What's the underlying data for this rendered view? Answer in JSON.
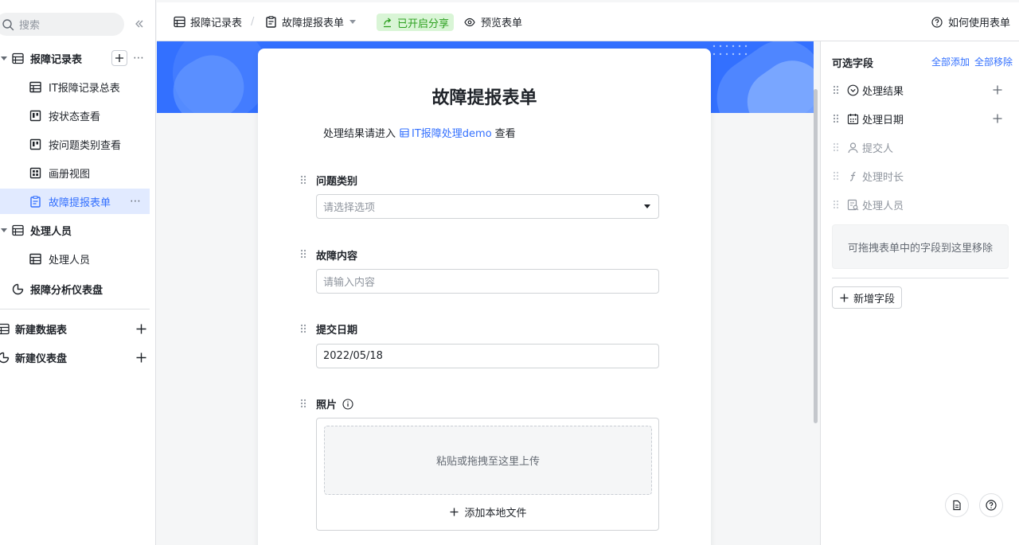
{
  "sidebar": {
    "search_placeholder": "搜索",
    "items": [
      {
        "label": "报障记录表",
        "level": 0,
        "icon": "table-icon"
      },
      {
        "label": "IT报障记录总表",
        "level": 1,
        "icon": "grid-view-icon"
      },
      {
        "label": "按状态查看",
        "level": 1,
        "icon": "kanban-view-icon"
      },
      {
        "label": "按问题类别查看",
        "level": 1,
        "icon": "kanban-view-icon"
      },
      {
        "label": "画册视图",
        "level": 1,
        "icon": "gallery-view-icon"
      },
      {
        "label": "故障提报表单",
        "level": 1,
        "icon": "form-view-icon",
        "selected": true
      },
      {
        "label": "处理人员",
        "level": 0,
        "icon": "table-icon"
      },
      {
        "label": "处理人员",
        "level": 1,
        "icon": "grid-view-icon"
      },
      {
        "label": "报障分析仪表盘",
        "level": 0,
        "icon": "dashboard-icon"
      }
    ],
    "new_table_label": "新建数据表",
    "new_dashboard_label": "新建仪表盘"
  },
  "topbar": {
    "breadcrumb_table": "报障记录表",
    "breadcrumb_view": "故障提报表单",
    "share_label": "已开启分享",
    "preview_label": "预览表单",
    "help_label": "如何使用表单"
  },
  "form": {
    "title": "故障提报表单",
    "desc_prefix": "处理结果请进入",
    "desc_link": "IT报障处理demo",
    "desc_suffix": "查看",
    "fields": [
      {
        "label": "问题类别",
        "placeholder": "请选择选项",
        "type": "select"
      },
      {
        "label": "故障内容",
        "placeholder": "请输入内容",
        "type": "text"
      },
      {
        "label": "提交日期",
        "value": "2022/05/18",
        "type": "date"
      },
      {
        "label": "照片",
        "type": "attachment"
      }
    ],
    "upload_hint": "粘贴或拖拽至这里上传",
    "add_local_file": "添加本地文件"
  },
  "right_panel": {
    "title": "可选字段",
    "add_all": "全部添加",
    "remove_all": "全部移除",
    "fields": [
      {
        "label": "处理结果",
        "icon": "single-select-icon",
        "enabled": true
      },
      {
        "label": "处理日期",
        "icon": "calendar-icon",
        "enabled": true
      },
      {
        "label": "提交人",
        "icon": "person-icon",
        "enabled": false
      },
      {
        "label": "处理时长",
        "icon": "formula-icon",
        "enabled": false
      },
      {
        "label": "处理人员",
        "icon": "link-record-icon",
        "enabled": false
      }
    ],
    "remove_zone_text": "可拖拽表单中的字段到这里移除",
    "new_field_label": "新增字段"
  },
  "colors": {
    "accent": "#3370ff",
    "share_bg": "#d9f5d6",
    "share_text": "#2ea121",
    "banner": "#3370ff"
  }
}
